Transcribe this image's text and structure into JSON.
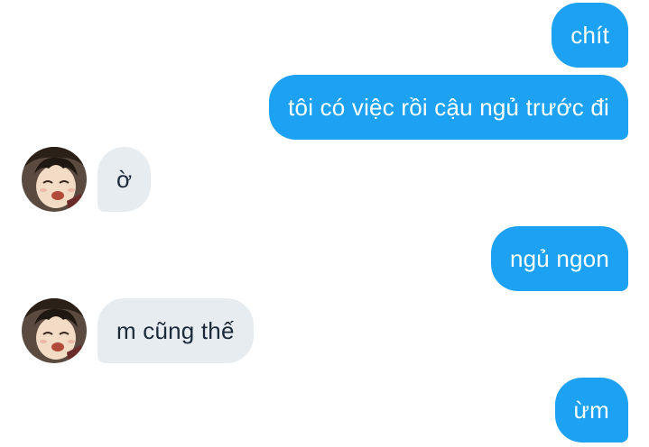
{
  "conversation": {
    "messages": [
      {
        "direction": "sent",
        "text": "chít"
      },
      {
        "direction": "sent",
        "text": "tôi có việc rồi cậu ngủ trước đi"
      },
      {
        "direction": "received",
        "text": "ờ",
        "avatar": "anime-boy-avatar"
      },
      {
        "direction": "sent",
        "text": "ngủ ngon"
      },
      {
        "direction": "received",
        "text": "m cũng thế",
        "avatar": "anime-boy-avatar"
      },
      {
        "direction": "sent",
        "text": "ừm"
      }
    ]
  },
  "colors": {
    "sent_bubble": "#1da1f2",
    "sent_text": "#ffffff",
    "received_bubble": "#e6ecf0",
    "received_text": "#1c2938",
    "background": "#ffffff"
  }
}
